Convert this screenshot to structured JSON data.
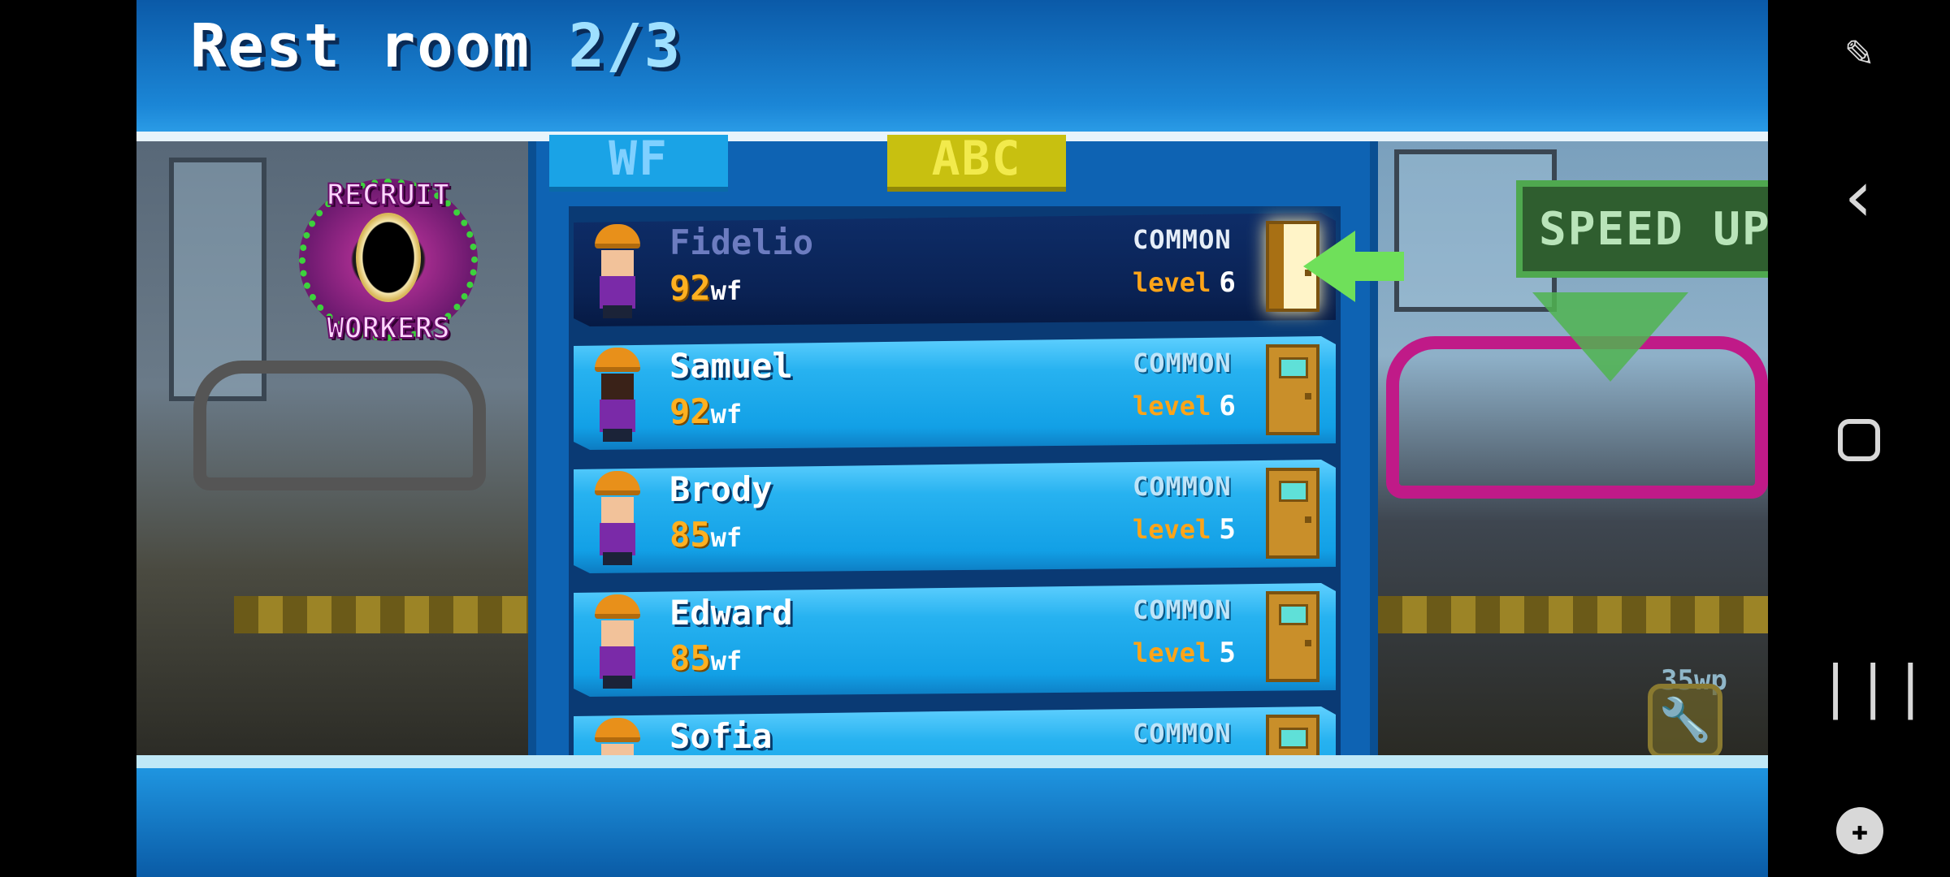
{
  "header": {
    "title": "Rest room",
    "count": "2/3"
  },
  "tabs": [
    {
      "label": "WF"
    },
    {
      "label": "ABC"
    }
  ],
  "recruit_sign": {
    "top": "RECRUIT",
    "bottom": "WORKERS"
  },
  "speed_up_sign": {
    "label": "SPEED UP"
  },
  "background_badge": {
    "label": "35wp"
  },
  "workers": [
    {
      "name": "Fidelio",
      "wf": "92",
      "wf_unit": "wf",
      "rarity": "COMMON",
      "level_label": "level",
      "level": "6",
      "selected": true
    },
    {
      "name": "Samuel",
      "wf": "92",
      "wf_unit": "wf",
      "rarity": "COMMON",
      "level_label": "level",
      "level": "6",
      "selected": false
    },
    {
      "name": "Brody",
      "wf": "85",
      "wf_unit": "wf",
      "rarity": "COMMON",
      "level_label": "level",
      "level": "5",
      "selected": false
    },
    {
      "name": "Edward",
      "wf": "85",
      "wf_unit": "wf",
      "rarity": "COMMON",
      "level_label": "level",
      "level": "5",
      "selected": false
    },
    {
      "name": "Sofia",
      "wf": "",
      "wf_unit": "",
      "rarity": "COMMON",
      "level_label": "",
      "level": "",
      "selected": false
    }
  ],
  "nav": {
    "pointer_icon": "mouse-pointer-icon",
    "back_icon": "back-chevron-icon",
    "home_icon": "home-square-icon",
    "recent_icon": "recent-apps-icon",
    "game_icon": "game-controller-icon"
  },
  "colors": {
    "accent_blue": "#1b86d6",
    "wf_orange": "#ffb020",
    "level_orange": "#ffa418",
    "pointer_green": "#6fe05a"
  }
}
